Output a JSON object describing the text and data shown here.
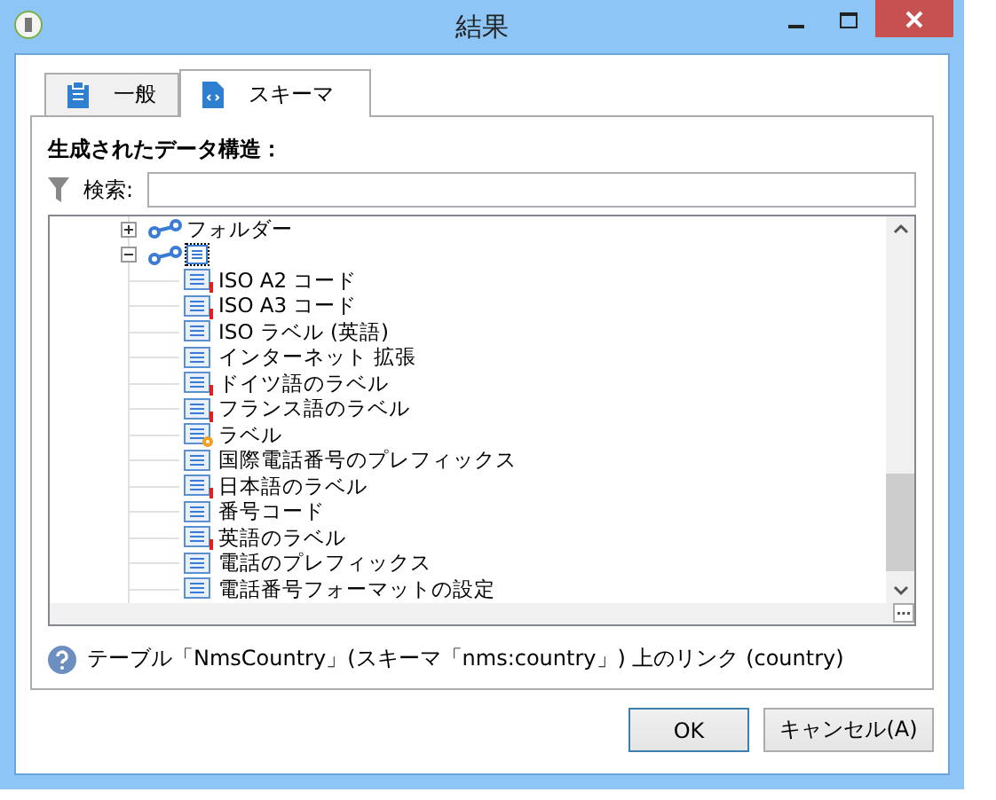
{
  "window": {
    "title": "結果"
  },
  "tabs": [
    {
      "label": "一般",
      "selected": false,
      "kind": "general"
    },
    {
      "label": "スキーマ",
      "selected": true,
      "kind": "schema"
    }
  ],
  "section_title": "生成されたデータ構造：",
  "search": {
    "label": "検索:"
  },
  "tree": [
    {
      "label": "フォルダー",
      "kind": "link",
      "expanded": false,
      "selected": false
    },
    {
      "kind": "link",
      "expanded": true,
      "selected": true,
      "children": [
        {
          "label": "ISO A2 コード",
          "kind": "field",
          "required": true
        },
        {
          "label": "ISO A3 コード",
          "kind": "field",
          "required": true
        },
        {
          "label": "ISO ラベル (英語)",
          "kind": "field",
          "required": false
        },
        {
          "label": "インターネット 拡張",
          "kind": "field",
          "required": false
        },
        {
          "label": "ドイツ語のラベル",
          "kind": "field",
          "required": true
        },
        {
          "label": "フランス語のラベル",
          "kind": "field",
          "required": true
        },
        {
          "label": "ラベル",
          "kind": "computed",
          "required": false
        },
        {
          "label": "国際電話番号のプレフィックス",
          "kind": "field",
          "required": false
        },
        {
          "label": "日本語のラベル",
          "kind": "field",
          "required": true
        },
        {
          "label": "番号コード",
          "kind": "field",
          "required": false
        },
        {
          "label": "英語のラベル",
          "kind": "field",
          "required": true
        },
        {
          "label": "電話のプレフィックス",
          "kind": "field",
          "required": false
        },
        {
          "label": "電話番号フォーマットの設定",
          "kind": "field",
          "required": false
        }
      ]
    }
  ],
  "status": "テーブル「NmsCountry」(スキーマ「nms:country」) 上のリンク (country)",
  "buttons": [
    {
      "label": "OK",
      "default": true
    },
    {
      "label": "キャンセル(A)",
      "default": false
    }
  ]
}
